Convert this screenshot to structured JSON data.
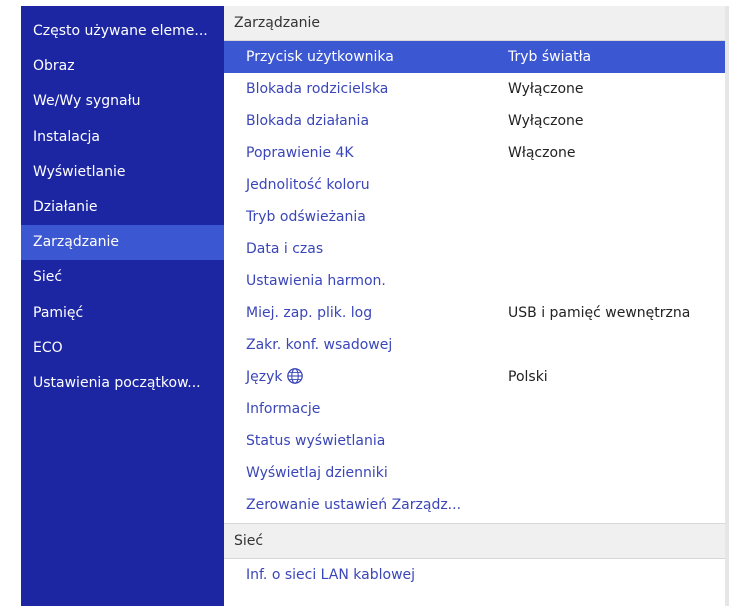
{
  "sidebar": {
    "items": [
      {
        "label": "Często używane eleme..."
      },
      {
        "label": "Obraz"
      },
      {
        "label": "We/Wy sygnału"
      },
      {
        "label": "Instalacja"
      },
      {
        "label": "Wyświetlanie"
      },
      {
        "label": "Działanie"
      },
      {
        "label": "Zarządzanie"
      },
      {
        "label": "Sieć"
      },
      {
        "label": "Pamięć"
      },
      {
        "label": "ECO"
      },
      {
        "label": "Ustawienia początkow..."
      }
    ]
  },
  "main": {
    "section_title": "Zarządzanie",
    "rows": [
      {
        "label": "Przycisk użytkownika",
        "value": "Tryb światła"
      },
      {
        "label": "Blokada rodzicielska",
        "value": "Wyłączone"
      },
      {
        "label": "Blokada działania",
        "value": "Wyłączone"
      },
      {
        "label": "Poprawienie 4K",
        "value": "Włączone"
      },
      {
        "label": "Jednolitość koloru",
        "value": ""
      },
      {
        "label": "Tryb odświeżania",
        "value": ""
      },
      {
        "label": "Data i czas",
        "value": ""
      },
      {
        "label": "Ustawienia harmon.",
        "value": ""
      },
      {
        "label": "Miej. zap. plik. log",
        "value": "USB i pamięć wewnętrzna"
      },
      {
        "label": "Zakr. konf. wsadowej",
        "value": ""
      },
      {
        "label": "Język",
        "value": "Polski"
      },
      {
        "label": "Informacje",
        "value": ""
      },
      {
        "label": "Status wyświetlania",
        "value": ""
      },
      {
        "label": "Wyświetlaj dzienniki",
        "value": ""
      },
      {
        "label": "Zerowanie ustawień Zarządz...",
        "value": ""
      }
    ],
    "section2_title": "Sieć",
    "section2_rows": [
      {
        "label": "Inf. o sieci LAN kablowej"
      }
    ]
  },
  "icons": {
    "language": "globe-icon"
  },
  "colors": {
    "sidebar_bg": "#1c26a3",
    "highlight": "#3b57d1",
    "link_text": "#3a46b8"
  }
}
